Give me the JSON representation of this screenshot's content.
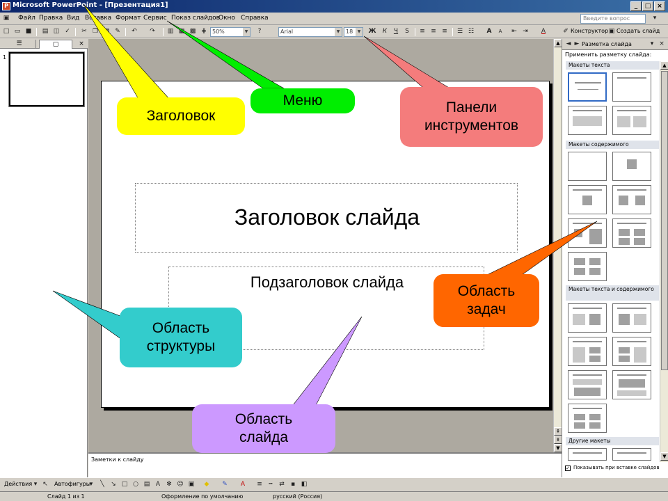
{
  "window": {
    "title": "Microsoft PowerPoint - [Презентация1]",
    "buttons": [
      "_",
      "□",
      "×"
    ]
  },
  "menu": {
    "items": [
      "Файл",
      "Правка",
      "Вид",
      "Вставка",
      "Формат",
      "Сервис",
      "Показ слайдов",
      "Окно",
      "Справка"
    ],
    "help_placeholder": "Введите вопрос"
  },
  "toolbar": {
    "zoom": "50%",
    "font": "Arial",
    "size": "18",
    "designer": "Конструктор",
    "new_slide": "Создать слайд"
  },
  "left_pane": {
    "tabs": [
      "☰",
      "▢"
    ],
    "slide_number": "1"
  },
  "slide": {
    "title": "Заголовок слайда",
    "subtitle": "Подзаголовок слайда"
  },
  "notes": {
    "placeholder": "Заметки к слайду"
  },
  "task_pane": {
    "title": "Разметка слайда",
    "apply_label": "Применить разметку слайда:",
    "sections": [
      "Макеты текста",
      "Макеты содержимого",
      "Макеты текста и содержимого",
      "Другие макеты"
    ],
    "footer": "Показывать при вставке слайдов"
  },
  "draw_toolbar": {
    "actions": "Действия",
    "autoshapes": "Автофигуры"
  },
  "status": {
    "slide_of": "Слайд 1 из 1",
    "design": "Оформление по умолчанию",
    "language": "русский (Россия)"
  },
  "callouts": {
    "title": "Заголовок",
    "menu": "Меню",
    "toolbars": "Панели инструментов",
    "task_area": "Область задач",
    "structure": "Область структуры",
    "slide_area": "Область слайда"
  },
  "colors": {
    "title_callout": "#ffff00",
    "menu_callout": "#00ee00",
    "toolbars_callout": "#f47c7c",
    "task_callout": "#ff6600",
    "structure_callout": "#33cccc",
    "slide_callout": "#cc99ff"
  }
}
